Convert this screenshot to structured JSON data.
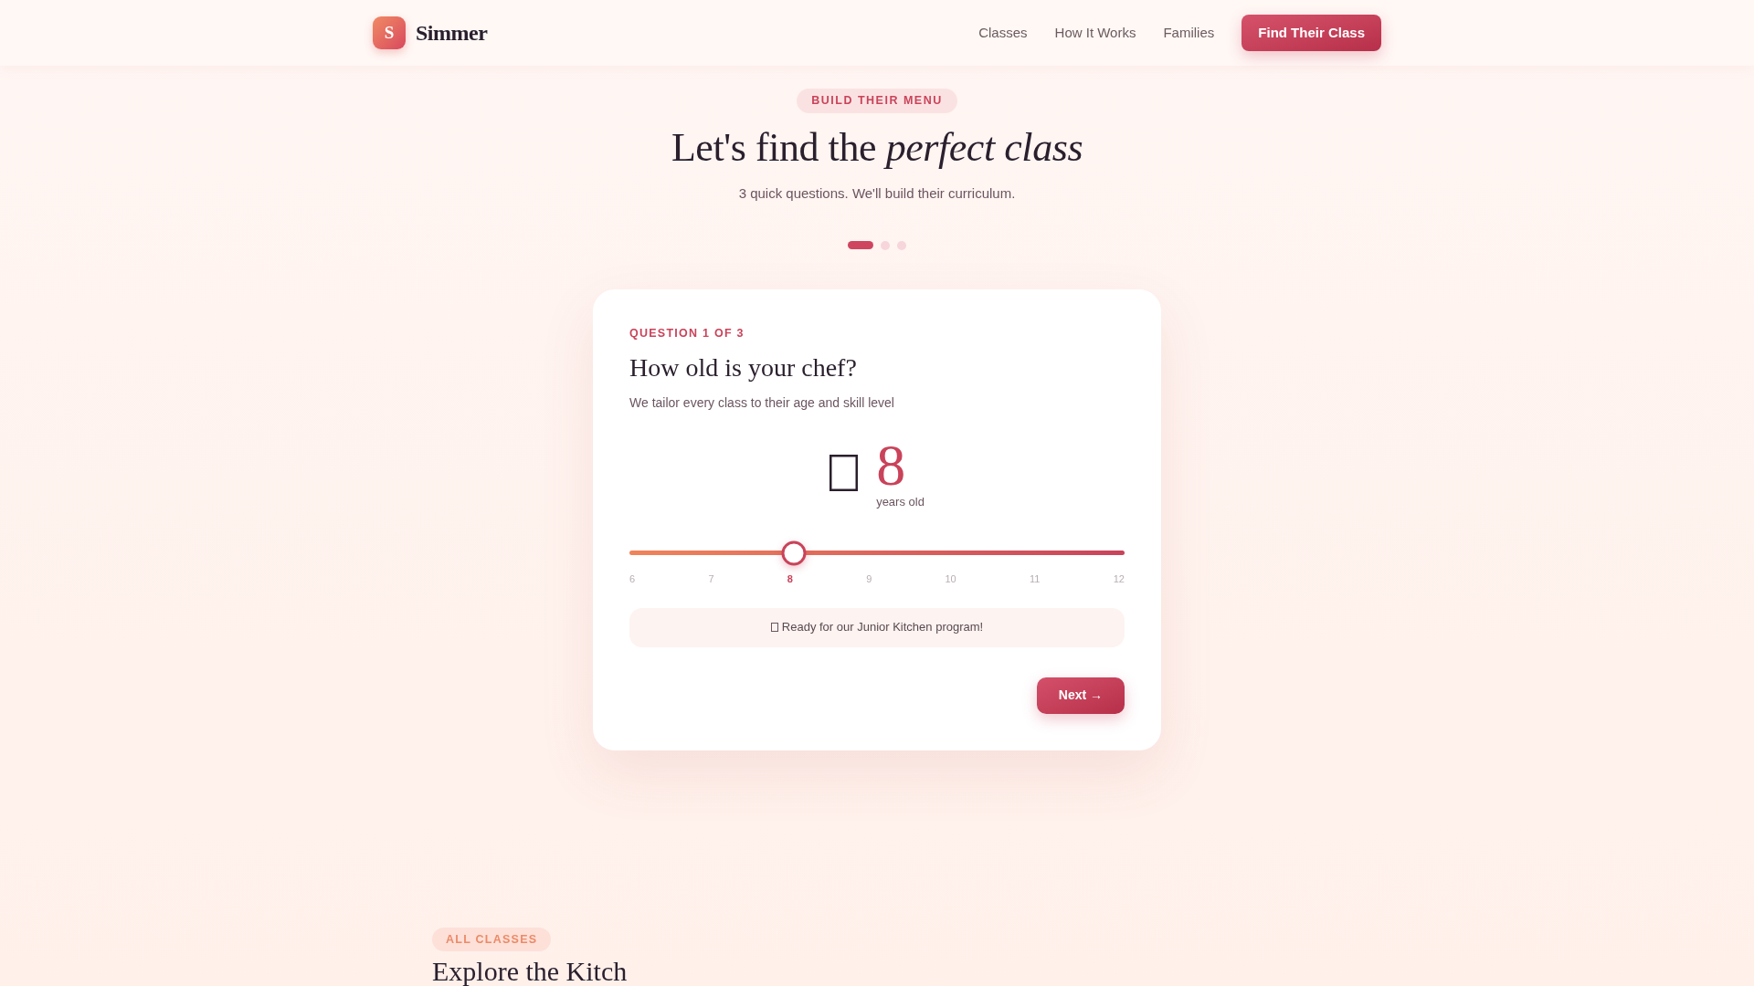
{
  "header": {
    "logo_letter": "S",
    "brand": "Simmer",
    "nav": [
      {
        "label": "Classes"
      },
      {
        "label": "How It Works"
      },
      {
        "label": "Families"
      }
    ],
    "cta": "Find Their Class"
  },
  "hero": {
    "eyebrow": "BUILD THEIR MENU",
    "title": "Let's find the *perfect class*",
    "subtitle": "3 quick questions. We'll build their curriculum.",
    "steps": [
      {
        "selected": true
      },
      {
        "selected": false
      },
      {
        "selected": false
      }
    ]
  },
  "question_card": {
    "step_label": "QUESTION 1 OF 3",
    "question": "How old is your chef?",
    "hint": "We tailor every class to their age and skill level",
    "value": "8",
    "unit": "years old",
    "slider": {
      "level": 0.333
    },
    "ticks": [
      {
        "label": "6",
        "selected": false
      },
      {
        "label": "7",
        "selected": false
      },
      {
        "label": "8",
        "selected": true
      },
      {
        "label": "9",
        "selected": false
      },
      {
        "label": "10",
        "selected": false
      },
      {
        "label": "11",
        "selected": false
      },
      {
        "label": "12",
        "selected": false
      }
    ],
    "message": "Ready for our Junior Kitchen program!",
    "next_button": "Next →"
  },
  "classes_section": {
    "eyebrow": "ALL CLASSES",
    "title": "Explore the Kitch"
  }
}
